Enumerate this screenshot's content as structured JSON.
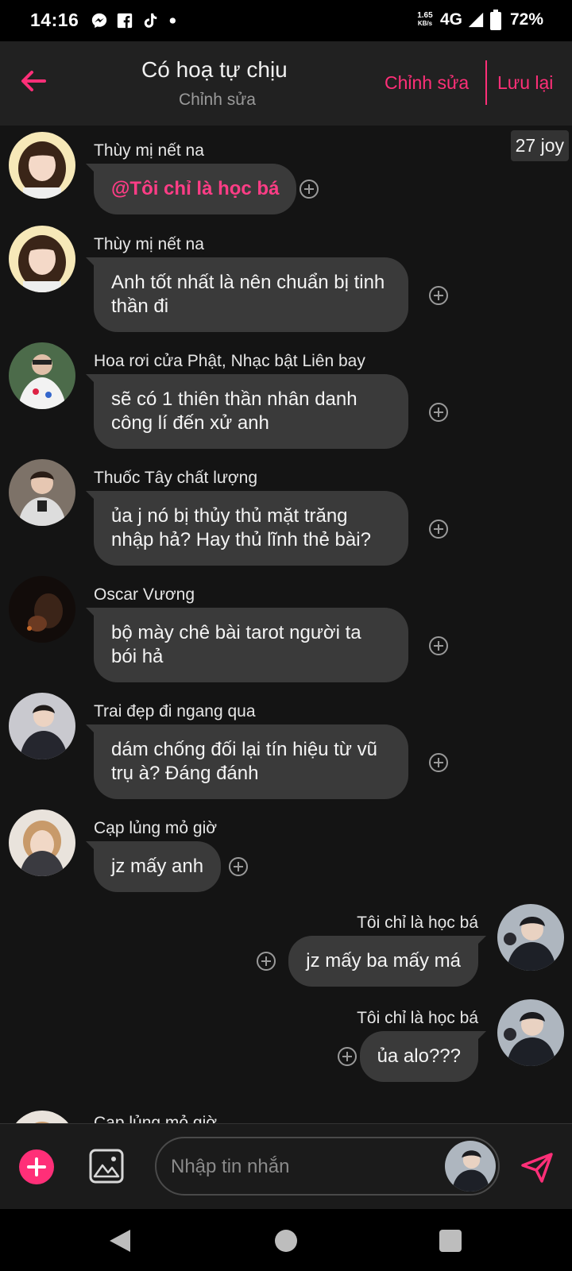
{
  "status_bar": {
    "time": "14:16",
    "app_icons": [
      "messenger-icon",
      "facebook-icon",
      "tiktok-icon",
      "dot-icon"
    ],
    "speed_value": "1.65",
    "speed_unit": "KB/s",
    "network": "4G",
    "battery": "72%"
  },
  "header": {
    "title": "Có hoạ tự chịu",
    "subtitle": "Chỉnh sửa",
    "edit_label": "Chỉnh sửa",
    "save_label": "Lưu lại",
    "accent_color": "#ff2f78"
  },
  "chat": {
    "badge": "27 joy",
    "messages": [
      {
        "side": "left",
        "sender": "Thùy mị nết na",
        "text": "@Tôi chỉ là học bá",
        "mention": true
      },
      {
        "side": "left",
        "sender": "Thùy mị nết na",
        "text": "Anh tốt nhất là nên chuẩn bị tinh thần đi"
      },
      {
        "side": "left",
        "sender": "Hoa rơi cửa Phật, Nhạc bật Liên bay",
        "text": "sẽ có 1 thiên thần nhân danh công lí đến xử anh"
      },
      {
        "side": "left",
        "sender": "Thuốc Tây chất lượng",
        "text": "ủa j nó bị thủy thủ mặt trăng nhập hả? Hay thủ lĩnh thẻ bài?"
      },
      {
        "side": "left",
        "sender": "Oscar Vương",
        "text": "bộ mày chê bài tarot người ta bói hả"
      },
      {
        "side": "left",
        "sender": "Trai đẹp đi ngang qua",
        "text": "dám chống đối lại tín hiệu từ vũ trụ à? Đáng đánh"
      },
      {
        "side": "left",
        "sender": "Cạp lủng mỏ giờ",
        "text": "jz mấy anh"
      },
      {
        "side": "right",
        "sender": "Tôi chỉ là học bá",
        "text": "jz mấy ba mấy má"
      },
      {
        "side": "right",
        "sender": "Tôi chỉ là học bá",
        "text": "ủa alo???"
      },
      {
        "side": "left",
        "sender": "Cạp lủng mỏ giờ",
        "text": ""
      }
    ]
  },
  "composer": {
    "placeholder": "Nhập tin nhắn"
  }
}
